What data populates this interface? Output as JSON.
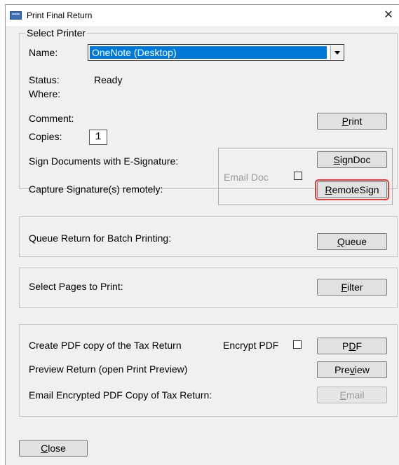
{
  "window": {
    "title": "Print Final Return",
    "close_symbol": "✕"
  },
  "select_printer": {
    "group_title": "Select Printer",
    "name_label": "Name:",
    "printer_name": "OneNote (Desktop)",
    "status_label": "Status:",
    "status_value": "Ready",
    "where_label": "Where:",
    "comment_label": "Comment:",
    "copies_label": "Copies:",
    "copies_value": "1",
    "sign_label": "Sign Documents with E-Signature:",
    "capture_label": "Capture Signature(s) remotely:",
    "email_doc_label": "Email Doc",
    "email_doc_checked": false,
    "print_button": {
      "pre": "",
      "ul": "P",
      "post": "rint"
    },
    "signdoc_button": {
      "pre": "",
      "ul": "S",
      "post": "ignDoc"
    },
    "remotesign_button": {
      "pre": "",
      "ul": "R",
      "post": "emoteSign"
    }
  },
  "queue_section": {
    "label": "Queue Return for Batch Printing:",
    "button": {
      "pre": "",
      "ul": "Q",
      "post": "ueue"
    }
  },
  "filter_section": {
    "label": "Select Pages to Print:",
    "button": {
      "pre": "",
      "ul": "F",
      "post": "ilter"
    }
  },
  "pdf_section": {
    "create_label": "Create PDF copy of the Tax Return",
    "encrypt_label": "Encrypt PDF",
    "encrypt_checked": false,
    "pdf_button": {
      "pre": "P",
      "ul": "D",
      "post": "F"
    },
    "preview_label": "Preview Return (open Print Preview)",
    "preview_button": {
      "pre": "Pre",
      "ul": "v",
      "post": "iew"
    },
    "email_label": "Email Encrypted PDF Copy of Tax Return:",
    "email_button": {
      "pre": "",
      "ul": "E",
      "post": "mail",
      "disabled": true
    }
  },
  "close_button": {
    "pre": "",
    "ul": "C",
    "post": "lose"
  },
  "colors": {
    "selection": "#0078d7",
    "focus_outline": "#e03c3c",
    "dialog_bg": "#f0f0f0"
  }
}
